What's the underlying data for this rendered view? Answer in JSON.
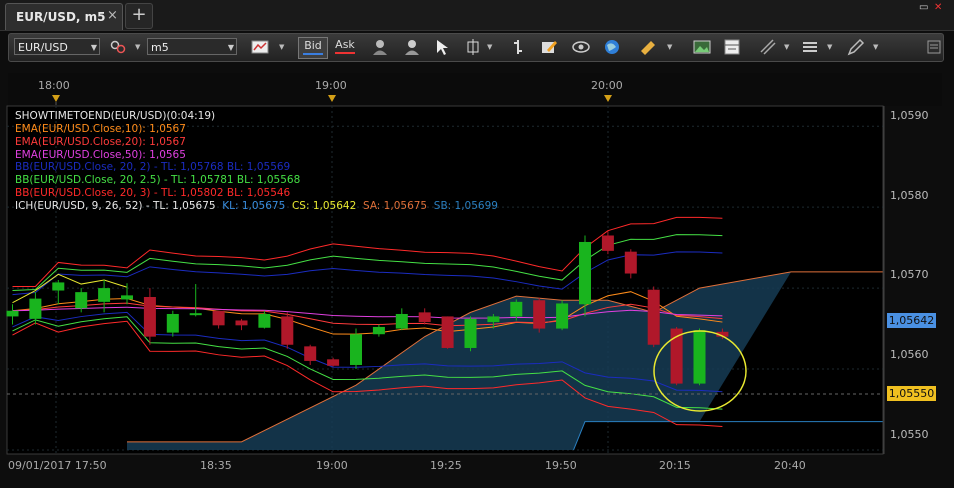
{
  "tab": {
    "title": "EUR/USD, m5",
    "close": "×",
    "add": "+"
  },
  "window": {
    "restore": "▭",
    "close": "✕"
  },
  "toolbar": {
    "symbol": "EUR/USD",
    "timeframe": "m5",
    "bid": "Bid",
    "ask": "Ask",
    "icons": [
      "chain-link-icon",
      "chart-type-icon",
      "person-icon",
      "person-add-icon",
      "cursor-icon",
      "crosshair-icon",
      "bar-select-icon",
      "edit-icon",
      "eye-icon",
      "globe-icon",
      "ruler-icon",
      "image-icon",
      "layout-icon",
      "lines-icon",
      "list-icon",
      "pen-icon",
      "menu-icon"
    ]
  },
  "time_axis_top": [
    {
      "label": "18:00"
    },
    {
      "label": "19:00"
    },
    {
      "label": "20:00"
    }
  ],
  "time_axis_bottom": [
    "09/01/2017 17:50",
    "18:35",
    "19:00",
    "19:25",
    "19:50",
    "20:15",
    "20:40"
  ],
  "price_axis": [
    "1,0590",
    "1,0580",
    "1,0570",
    "1,0560",
    "1,0550"
  ],
  "price_tags": {
    "current": "1,05642",
    "line": "1,05550"
  },
  "indicators": [
    {
      "text": "SHOWTIMETOEND(EUR/USD)(0:04:19)",
      "color": "#e8e8e8"
    },
    {
      "text": "EMA(EUR/USD.Close,10): 1,0567",
      "color": "#ff8c1a"
    },
    {
      "text": "EMA(EUR/USD.Close,20): 1,0567",
      "color": "#ff3b3b"
    },
    {
      "text": "EMA(EUR/USD.Close,50): 1,0565",
      "color": "#e040e0"
    },
    {
      "text": "BB(EUR/USD.Close, 20, 2) -  TL: 1,05768  BL: 1,05569",
      "color": "#1b2cc0"
    },
    {
      "text": "BB(EUR/USD.Close, 20, 2.5) -  TL: 1,05781  BL: 1,05568",
      "color": "#45e045"
    },
    {
      "text": "BB(EUR/USD.Close, 20, 3) -  TL: 1,05802  BL: 1,05546",
      "color": "#ff2a2a"
    }
  ],
  "ichimoku": {
    "name": "ICH(EUR/USD, 9, 26, 52) -  TL: 1,05675",
    "kl": "KL: 1,05675",
    "cs": "CS: 1,05642",
    "sa": "SA: 1,05675",
    "sb": "SB: 1,05699"
  },
  "colors": {
    "bull": "#19b41e",
    "bear": "#b0182a",
    "current_tag": "#4a90e2",
    "line_tag": "#f0c020",
    "cloud": "#163c55"
  },
  "chart_data": {
    "type": "candlestick",
    "symbol": "EUR/USD",
    "timeframe": "m5",
    "ylim": [
      1.05495,
      1.05925
    ],
    "candles": [
      {
        "o": 1.05665,
        "h": 1.0568,
        "l": 1.05655,
        "c": 1.05672
      },
      {
        "o": 1.05662,
        "h": 1.05695,
        "l": 1.05655,
        "c": 1.05687
      },
      {
        "o": 1.05697,
        "h": 1.0571,
        "l": 1.0568,
        "c": 1.05707
      },
      {
        "o": 1.05675,
        "h": 1.057,
        "l": 1.0567,
        "c": 1.05695
      },
      {
        "o": 1.05683,
        "h": 1.0571,
        "l": 1.0567,
        "c": 1.057
      },
      {
        "o": 1.05686,
        "h": 1.05706,
        "l": 1.0568,
        "c": 1.05691
      },
      {
        "o": 1.05689,
        "h": 1.057,
        "l": 1.0563,
        "c": 1.0564
      },
      {
        "o": 1.05645,
        "h": 1.05672,
        "l": 1.0564,
        "c": 1.05668
      },
      {
        "o": 1.05668,
        "h": 1.05705,
        "l": 1.05665,
        "c": 1.05669
      },
      {
        "o": 1.05672,
        "h": 1.05672,
        "l": 1.0565,
        "c": 1.05654
      },
      {
        "o": 1.0566,
        "h": 1.05662,
        "l": 1.05648,
        "c": 1.05654
      },
      {
        "o": 1.05651,
        "h": 1.05672,
        "l": 1.0565,
        "c": 1.05668
      },
      {
        "o": 1.05665,
        "h": 1.0567,
        "l": 1.05625,
        "c": 1.0563
      },
      {
        "o": 1.05628,
        "h": 1.0563,
        "l": 1.05605,
        "c": 1.0561
      },
      {
        "o": 1.05612,
        "h": 1.05614,
        "l": 1.05603,
        "c": 1.05604
      },
      {
        "o": 1.05605,
        "h": 1.0565,
        "l": 1.056,
        "c": 1.05643
      },
      {
        "o": 1.05643,
        "h": 1.05655,
        "l": 1.0564,
        "c": 1.05652
      },
      {
        "o": 1.0565,
        "h": 1.05675,
        "l": 1.05648,
        "c": 1.05668
      },
      {
        "o": 1.0567,
        "h": 1.05675,
        "l": 1.05655,
        "c": 1.05658
      },
      {
        "o": 1.05665,
        "h": 1.05665,
        "l": 1.05625,
        "c": 1.05626
      },
      {
        "o": 1.05626,
        "h": 1.05665,
        "l": 1.05622,
        "c": 1.05662
      },
      {
        "o": 1.05658,
        "h": 1.05668,
        "l": 1.0565,
        "c": 1.05665
      },
      {
        "o": 1.05665,
        "h": 1.05686,
        "l": 1.0566,
        "c": 1.05683
      },
      {
        "o": 1.05685,
        "h": 1.05688,
        "l": 1.05645,
        "c": 1.0565
      },
      {
        "o": 1.0565,
        "h": 1.05685,
        "l": 1.05648,
        "c": 1.05681
      },
      {
        "o": 1.0568,
        "h": 1.05765,
        "l": 1.05665,
        "c": 1.05757
      },
      {
        "o": 1.05765,
        "h": 1.0577,
        "l": 1.05742,
        "c": 1.05746
      },
      {
        "o": 1.05745,
        "h": 1.05748,
        "l": 1.05712,
        "c": 1.05718
      },
      {
        "o": 1.05698,
        "h": 1.05702,
        "l": 1.05627,
        "c": 1.0563
      },
      {
        "o": 1.0565,
        "h": 1.05652,
        "l": 1.0558,
        "c": 1.05582
      },
      {
        "o": 1.05582,
        "h": 1.0565,
        "l": 1.0558,
        "c": 1.05648
      },
      {
        "o": 1.05646,
        "h": 1.0565,
        "l": 1.05637,
        "c": 1.0564
      }
    ]
  }
}
